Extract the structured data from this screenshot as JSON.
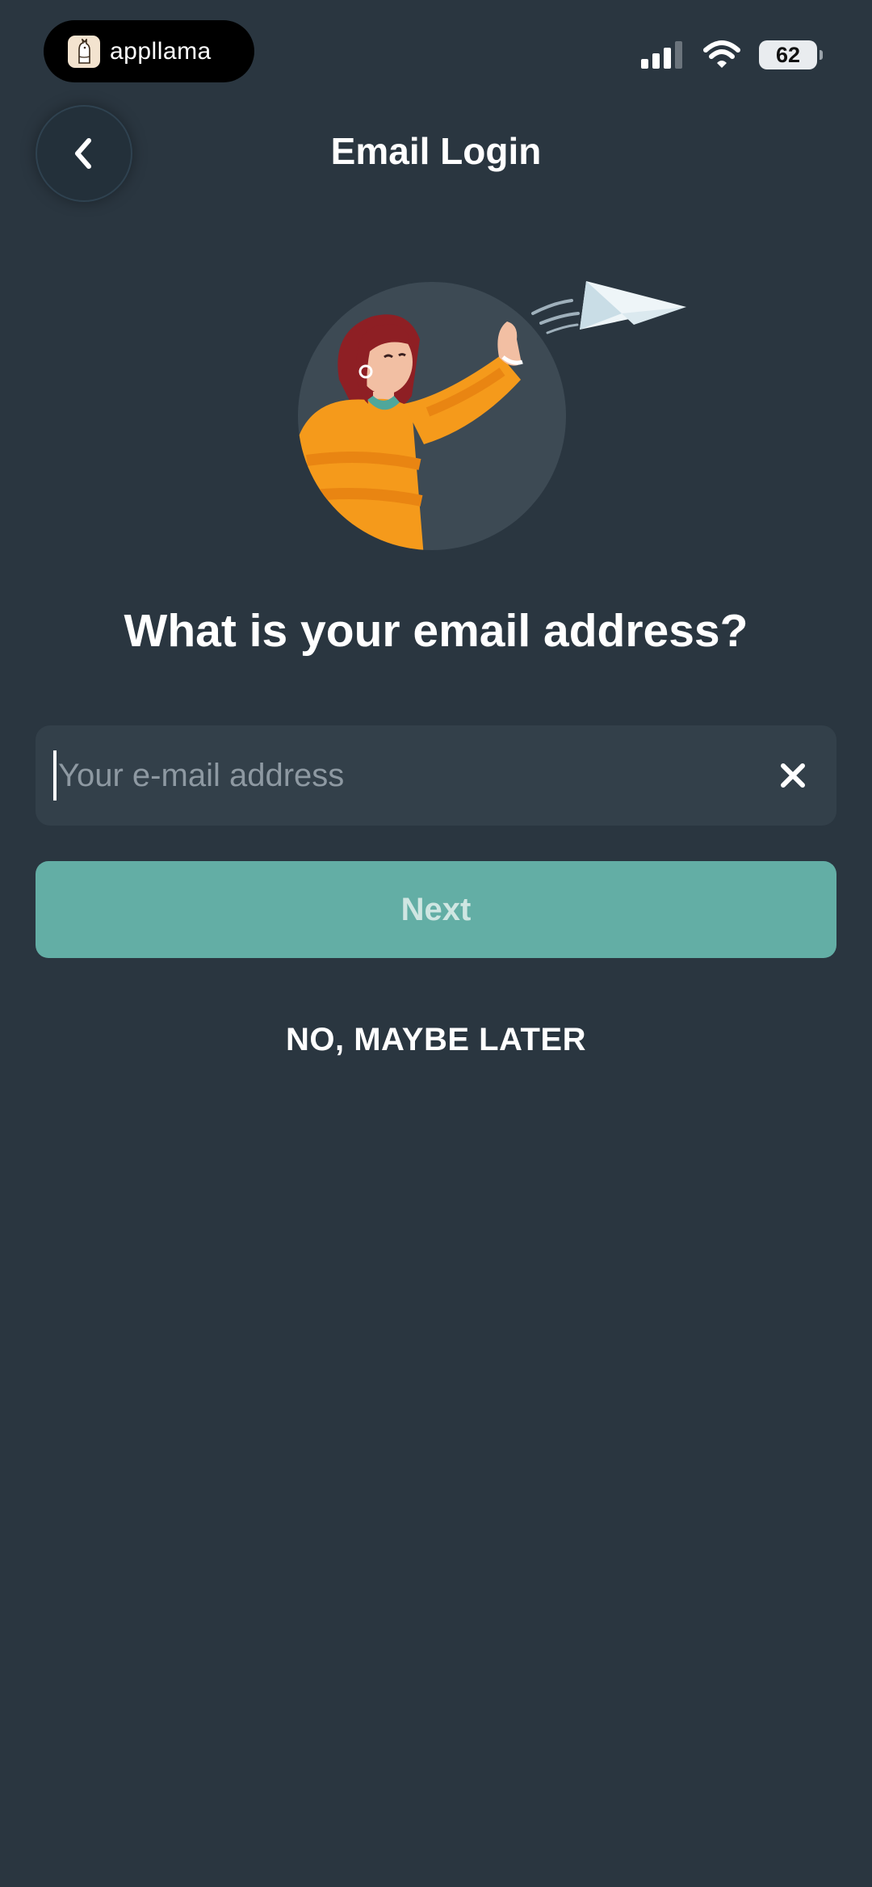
{
  "status_bar": {
    "app_name": "appllama",
    "battery": "62",
    "icons": [
      "cellular-signal-icon",
      "wifi-icon",
      "battery-icon"
    ]
  },
  "header": {
    "back_icon": "chevron-left-icon",
    "title": "Email Login"
  },
  "illustration": {
    "name": "woman-throwing-paper-plane"
  },
  "main": {
    "question": "What is your email address?",
    "email": {
      "value": "",
      "placeholder": "Your e-mail address",
      "clear_icon": "close-icon"
    },
    "next_label": "Next",
    "later_label": "NO, MAYBE LATER"
  },
  "colors": {
    "background": "#2a3640",
    "field": "#33404a",
    "accent": "#63aea5",
    "sweater": "#f59a1b",
    "hair": "#8e1f24"
  }
}
